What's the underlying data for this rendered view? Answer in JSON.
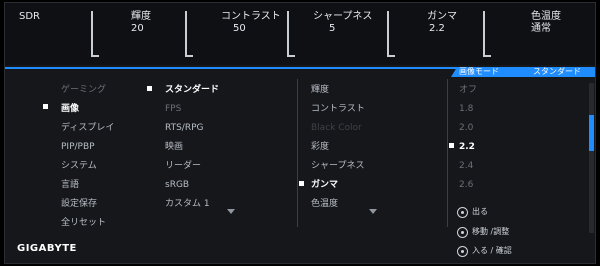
{
  "top": {
    "mode": "SDR",
    "items": [
      {
        "label": "輝度",
        "value": "20"
      },
      {
        "label": "コントラスト",
        "value": "50"
      },
      {
        "label": "シャープネス",
        "value": "5"
      },
      {
        "label": "ガンマ",
        "value": "2.2"
      },
      {
        "label": "色温度",
        "value": "通常"
      }
    ]
  },
  "mode_bar": {
    "label": "画像モード",
    "value": "スタンダード"
  },
  "menu": {
    "items": [
      "ゲーミング",
      "画像",
      "ディスプレイ",
      "PIP/PBP",
      "システム",
      "言語",
      "設定保存",
      "全リセット"
    ],
    "active_index": 1
  },
  "picture_modes": {
    "items": [
      "スタンダード",
      "FPS",
      "RTS/RPG",
      "映画",
      "リーダー",
      "sRGB",
      "カスタム 1"
    ],
    "active_index": 0
  },
  "settings": {
    "items": [
      "輝度",
      "コントラスト",
      "Black Color",
      "彩度",
      "シャープネス",
      "ガンマ",
      "色温度"
    ],
    "active_index": 5
  },
  "gamma_values": {
    "items": [
      "オフ",
      "1.8",
      "2.0",
      "2.2",
      "2.4",
      "2.6"
    ],
    "active_index": 3
  },
  "help": {
    "exit": "出る",
    "move": "移動 /調整",
    "enter": "入る / 確認"
  },
  "brand": "GIGABYTE"
}
